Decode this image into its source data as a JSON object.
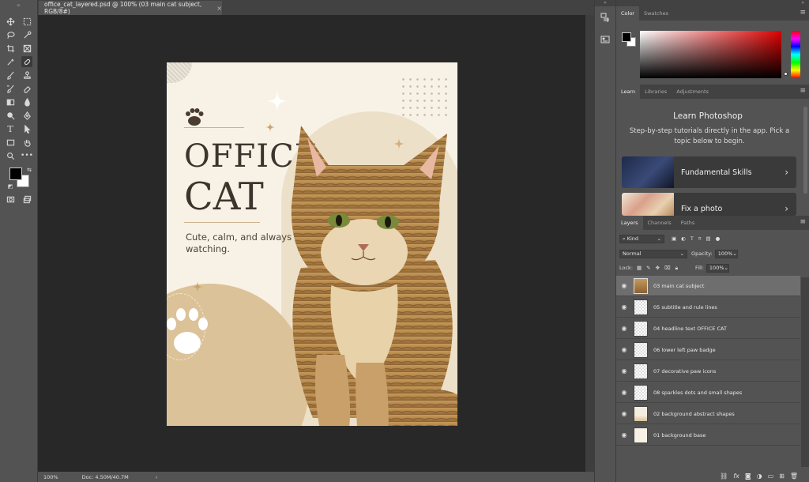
{
  "document": {
    "tab_title": "office_cat_layered.psd @ 100% (03 main cat subject, RGB/8#)",
    "tab_close": "×"
  },
  "status": {
    "zoom": "100%",
    "doc_info": "Doc: 4.50M/40.7M",
    "arrow": "›"
  },
  "artwork": {
    "headline_line1": "OFFICE",
    "headline_line2": "CAT",
    "subtitle": "Cute, calm, and always watching.",
    "colors": {
      "cream": "#f8f2e6",
      "tan": "#dcc298",
      "arch": "#ece0c8",
      "ink": "#3d352d"
    }
  },
  "color_panel": {
    "tabs": [
      "Color",
      "Swatches"
    ],
    "active_tab": "Color",
    "foreground": "#000000",
    "background": "#ffffff",
    "hue": "#e00000"
  },
  "learn_panel": {
    "tabs": [
      "Learn",
      "Libraries",
      "Adjustments"
    ],
    "title": "Learn Photoshop",
    "description": "Step-by-step tutorials directly in the app. Pick a topic below to begin.",
    "cards": [
      {
        "label": "Fundamental Skills"
      },
      {
        "label": "Fix a photo"
      }
    ]
  },
  "layers_panel": {
    "tabs": [
      "Layers",
      "Channels",
      "Paths"
    ],
    "kind_filter": "Kind",
    "blend_mode": "Normal",
    "opacity_label": "Opacity:",
    "opacity_value": "100%",
    "lock_label": "Lock:",
    "fill_label": "Fill:",
    "fill_value": "100%",
    "layers": [
      {
        "name": "03 main cat subject",
        "selected": true
      },
      {
        "name": "05 subtitle and rule lines",
        "selected": false
      },
      {
        "name": "04 headline text OFFICE CAT",
        "selected": false
      },
      {
        "name": "06 lower left paw badge",
        "selected": false
      },
      {
        "name": "07 decorative paw icons",
        "selected": false
      },
      {
        "name": "08 sparkles dots and small shapes",
        "selected": false
      },
      {
        "name": "02 background abstract shapes",
        "selected": false
      },
      {
        "name": "01 background base",
        "selected": false
      }
    ]
  },
  "icons": {
    "toolbar": [
      "move-icon",
      "marquee-icon",
      "lasso-icon",
      "quick-select-icon",
      "crop-icon",
      "frame-icon",
      "eyedropper-icon",
      "healing-icon",
      "brush-icon",
      "stamp-icon",
      "history-brush-icon",
      "eraser-icon",
      "gradient-icon",
      "blur-icon",
      "dodge-icon",
      "pen-icon",
      "type-icon",
      "path-select-icon",
      "rectangle-icon",
      "hand-icon",
      "zoom-icon",
      "more-icon"
    ]
  }
}
